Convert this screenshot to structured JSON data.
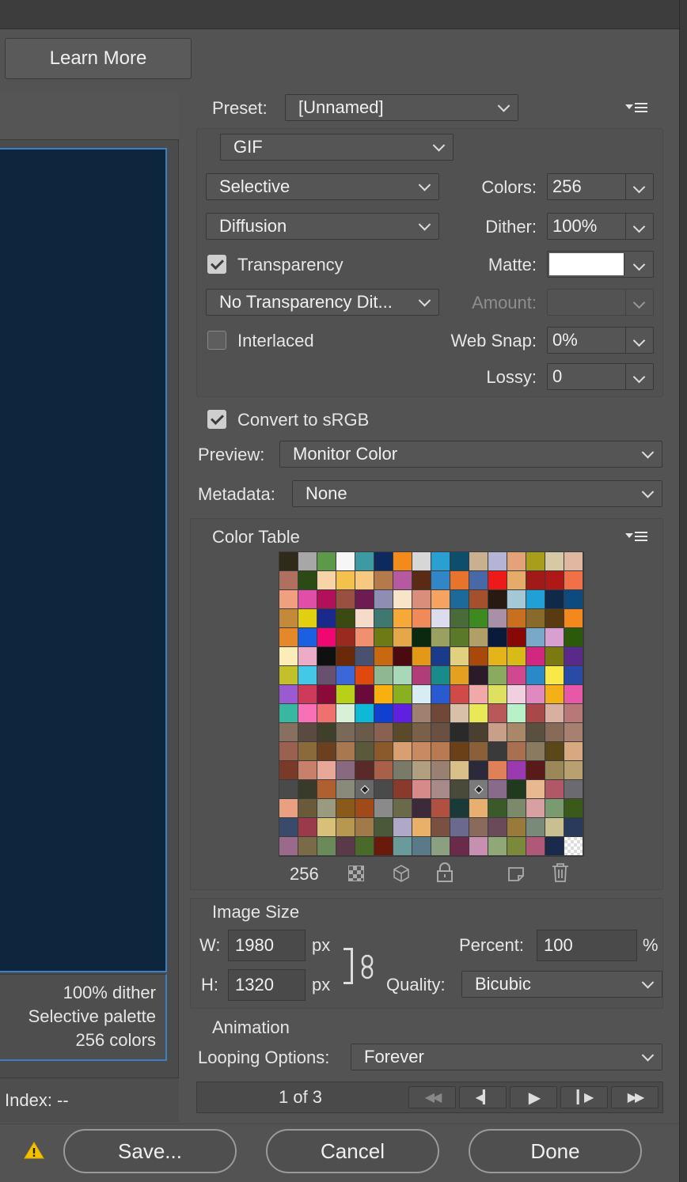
{
  "top": {
    "learn_more": "Learn More"
  },
  "preview_panel": {
    "info_lines": [
      "100% dither",
      "Selective palette",
      "256 colors"
    ],
    "index_label": "Index: --",
    "bg_color": "#0e263d"
  },
  "preset": {
    "label": "Preset:",
    "value": "[Unnamed]"
  },
  "format": {
    "value": "GIF"
  },
  "reduction": {
    "value": "Selective"
  },
  "dither_algo": {
    "value": "Diffusion"
  },
  "transparency": {
    "label": "Transparency",
    "checked": true
  },
  "transparency_dither": {
    "value": "No Transparency Dit..."
  },
  "interlaced": {
    "label": "Interlaced",
    "checked": false
  },
  "colors": {
    "label": "Colors:",
    "value": "256"
  },
  "dither": {
    "label": "Dither:",
    "value": "100%"
  },
  "matte": {
    "label": "Matte:",
    "color": "#ffffff"
  },
  "amount": {
    "label": "Amount:",
    "value": ""
  },
  "web_snap": {
    "label": "Web Snap:",
    "value": "0%"
  },
  "lossy": {
    "label": "Lossy:",
    "value": "0"
  },
  "convert_srgb": {
    "label": "Convert to sRGB",
    "checked": true
  },
  "preview": {
    "label": "Preview:",
    "value": "Monitor Color"
  },
  "metadata": {
    "label": "Metadata:",
    "value": "None"
  },
  "color_table": {
    "title": "Color Table",
    "count": "256",
    "rows": [
      [
        "#2f2a1a",
        "#a7a7a7",
        "#5c9a4a",
        "#f6f6f6",
        "#3d9aa3",
        "#0c2a5e",
        "#f28a1c",
        "#d7d7d7",
        "#2aa0d2",
        "#0c4e6c",
        "#c8b090",
        "#b4b4d6",
        "#e3a277",
        "#a99d1c",
        "#d8c9a6",
        "#e1b7a1"
      ],
      [
        "#b07060",
        "#2b4a14",
        "#f7d4a8",
        "#f4c24c",
        "#f6c97e",
        "#b47a4a",
        "#b65aa0",
        "#5a2a14",
        "#3086c6",
        "#e8742c",
        "#4868a6",
        "#ee1a1a",
        "#e4ac68",
        "#a01a1a",
        "#b01818",
        "#f07048"
      ],
      [
        "#f0a07e",
        "#e04eaa",
        "#b2105a",
        "#9a5040",
        "#6c1c52",
        "#8e8eb4",
        "#f8e4c8",
        "#d88e7a",
        "#f4a460",
        "#1b6a9a",
        "#a4502c",
        "#281a10",
        "#a4c8d6",
        "#20a0d6",
        "#0e2a48",
        "#0d4a80"
      ],
      [
        "#c48a3c",
        "#e0d010",
        "#1a2a8a",
        "#3a4a10",
        "#f6dcc8",
        "#3e7870",
        "#f6a838",
        "#f08a5a",
        "#dcdcec",
        "#4a6a3a",
        "#3c8a20",
        "#a890a8",
        "#c87020",
        "#8a6a2a",
        "#5a3a10",
        "#f4881c"
      ],
      [
        "#e4882a",
        "#1a60e0",
        "#f00870",
        "#9a2a20",
        "#f09070",
        "#6e7a14",
        "#e4a848",
        "#0a2a10",
        "#9aa060",
        "#5a7a2a",
        "#b0a068",
        "#0a1a3a",
        "#880808",
        "#7aa8c8",
        "#d8a0d0",
        "#2a5a0a"
      ],
      [
        "#fcecb8",
        "#ecacc8",
        "#101010",
        "#6a2a0a",
        "#4a5070",
        "#c86810",
        "#4a0a10",
        "#e49818",
        "#1a3a8a",
        "#e0d080",
        "#a8480a",
        "#e4b41a",
        "#d8ba18",
        "#d02880",
        "#7a7a10",
        "#5a2a8a"
      ],
      [
        "#c4c02a",
        "#44c8e8",
        "#6a5070",
        "#3a68d8",
        "#e04810",
        "#90b890",
        "#a8d8b8",
        "#b03c7a",
        "#1a8a8a",
        "#e4a020",
        "#2a1a2a",
        "#8aaa60",
        "#d04890",
        "#2a8ac8",
        "#f8e848",
        "#2a4aa8"
      ],
      [
        "#9a5ad0",
        "#d03a5a",
        "#8a0a3a",
        "#b8d018",
        "#6a0a3a",
        "#f8b010",
        "#8ab020",
        "#d8ecf4",
        "#2a5ad0",
        "#d04a48",
        "#f0a8a8",
        "#e0e060",
        "#f0d0e0",
        "#e088c0",
        "#f4b018",
        "#e858a8"
      ],
      [
        "#38b8a0",
        "#f870b8",
        "#f07070",
        "#d8f0d8",
        "#10b8d8",
        "#1040d0",
        "#6020e0",
        "#a08070",
        "#704838",
        "#d8c0a8",
        "#e8e858",
        "#b85858",
        "#b8f0c8",
        "#a84848",
        "#d8b0a0",
        "#b87878"
      ],
      [
        "#887060",
        "#5a4a40",
        "#40402a",
        "#7a6858",
        "#6a5a4a",
        "#8a6050",
        "#5a4a2a",
        "#7a6048",
        "#6a5040",
        "#2a2a2a",
        "#4a4030",
        "#c8a088",
        "#a88868",
        "#5a5040",
        "#886a58",
        "#a88070"
      ],
      [
        "#9a6050",
        "#8a6a3a",
        "#6a4020",
        "#a87850",
        "#5a5a3a",
        "#8a5a2a",
        "#d8a070",
        "#c88a60",
        "#b87a50",
        "#6a4018",
        "#8a6038",
        "#3a3a3a",
        "#a87050",
        "#8a7a60",
        "#5a4818",
        "#d8a880"
      ],
      [
        "#7a3a2a",
        "#c8806a",
        "#e8a898",
        "#886a80",
        "#5a2a2a",
        "#a86048",
        "#7a7a6a",
        "#b0a080",
        "#9a8070",
        "#d8c088",
        "#2a2a3a",
        "#e08058",
        "#9a3ab0",
        "#5a1a1a",
        "#9a8858",
        "#b8a070"
      ],
      [
        "#4a4a4a",
        "#3a3a2a",
        "#b06030",
        "#8a8a7a",
        "#686868",
        "#4a4a4a",
        "#8a3a2a",
        "#d88a8a",
        "#a88a8a",
        "#4a4a3a",
        "#7a7a7a",
        "#8a6a8a",
        "#203a20",
        "#e8b890",
        "#b05868",
        "#6a6a70"
      ],
      [
        "#e8a080",
        "#6a5a3a",
        "#9a9a80",
        "#8a5a1a",
        "#a04a1a",
        "#8a8a8a",
        "#6a6a4a",
        "#3a2a3a",
        "#b05040",
        "#1a3a3a",
        "#e8b070",
        "#3a5a2a",
        "#7a8a6a",
        "#d8a0a0",
        "#7a9a70",
        "#3a5a1a"
      ],
      [
        "#3a4a6a",
        "#9a3a4a",
        "#d8c078",
        "#b89850",
        "#a07a48",
        "#4a5a38",
        "#b0a8c8",
        "#e8b068",
        "#7a5040",
        "#6a6a90",
        "#8a6a5a",
        "#6a4a5a",
        "#9a7a3a",
        "#7a8a7a",
        "#c8c090",
        "#2a3a5a"
      ],
      [
        "#9a6a8a",
        "#7a6a48",
        "#6a8a5a",
        "#5a3a48",
        "#4a6a2a",
        "#6a1a0a",
        "#6a9a9a",
        "#5a7a8a",
        "#8aa080",
        "#6a2a4a",
        "#c890b0",
        "#90a878",
        "#7a8a3a",
        "#b05878",
        "#1a2a4a",
        "#ffffff"
      ]
    ]
  },
  "image_size": {
    "title": "Image Size",
    "w_label": "W:",
    "w_value": "1980",
    "h_label": "H:",
    "h_value": "1320",
    "unit": "px",
    "percent_label": "Percent:",
    "percent_value": "100",
    "percent_unit": "%",
    "quality_label": "Quality:",
    "quality_value": "Bicubic"
  },
  "animation": {
    "title": "Animation",
    "looping_label": "Looping Options:",
    "looping_value": "Forever",
    "frame_counter": "1 of 3"
  },
  "footer": {
    "save": "Save...",
    "cancel": "Cancel",
    "done": "Done"
  }
}
